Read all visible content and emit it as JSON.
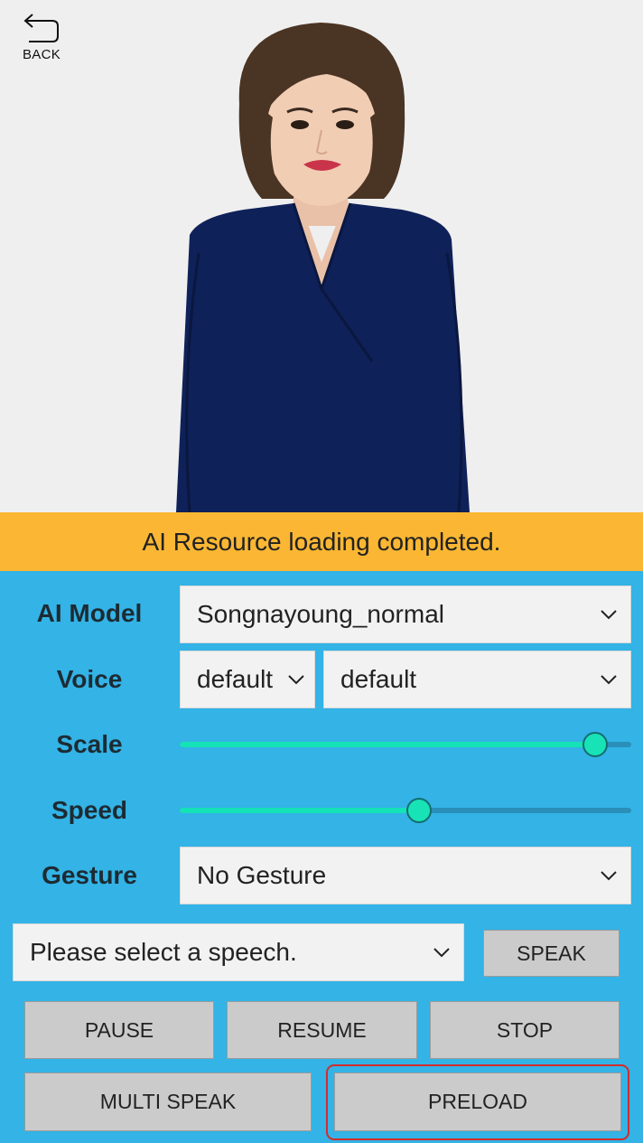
{
  "nav": {
    "back_label": "BACK"
  },
  "status": {
    "message": "AI Resource loading completed."
  },
  "controls": {
    "ai_model": {
      "label": "AI Model",
      "value": "Songnayoung_normal"
    },
    "voice": {
      "label": "Voice",
      "language_value": "default",
      "voice_value": "default"
    },
    "scale": {
      "label": "Scale",
      "value": 0.92
    },
    "speed": {
      "label": "Speed",
      "value": 0.53
    },
    "gesture": {
      "label": "Gesture",
      "value": "No Gesture"
    },
    "speech": {
      "value": "Please select a speech.",
      "speak_label": "SPEAK"
    }
  },
  "buttons": {
    "pause": "PAUSE",
    "resume": "RESUME",
    "stop": "STOP",
    "multi_speak": "MULTI SPEAK",
    "preload": "PRELOAD"
  },
  "colors": {
    "panel": "#33b3e6",
    "banner": "#fbb733",
    "slider_fill": "#15e2b6",
    "highlight": "#d32c2c"
  },
  "icons": {
    "back": "undo-arrow-icon",
    "dropdown": "chevron-down-icon"
  }
}
